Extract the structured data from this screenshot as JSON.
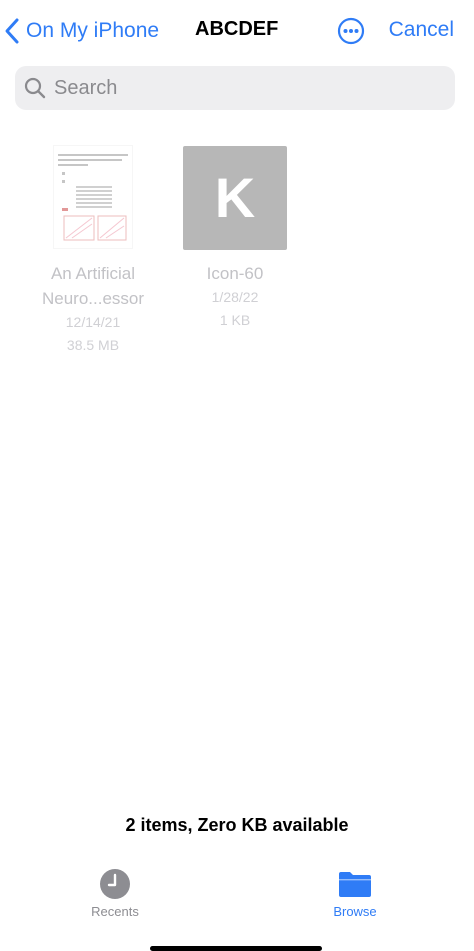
{
  "nav": {
    "back_label": "On My iPhone",
    "title": "ABCDEF",
    "more_icon": "ellipsis-circle-icon",
    "cancel_label": "Cancel"
  },
  "search": {
    "placeholder": "Search",
    "value": ""
  },
  "files": [
    {
      "name_line1": "An Artificial",
      "name_line2": "Neuro...essor",
      "date": "12/14/21",
      "size": "38.5 MB",
      "thumbnail": "document-thumbnail"
    },
    {
      "name_line1": "Icon-60",
      "name_line2": "",
      "date": "1/28/22",
      "size": "1 KB",
      "thumbnail": "image-thumbnail",
      "thumb_letter": "K"
    }
  ],
  "status": "2 items, Zero KB available",
  "tabs": [
    {
      "label": "Recents",
      "icon": "clock-icon",
      "active": false
    },
    {
      "label": "Browse",
      "icon": "folder-icon",
      "active": true
    }
  ],
  "colors": {
    "accent": "#2f7cf6",
    "search_bg": "#eeeef0",
    "inactive_tab": "#8d8d92",
    "dimmed_text": "#c2c2c6"
  }
}
